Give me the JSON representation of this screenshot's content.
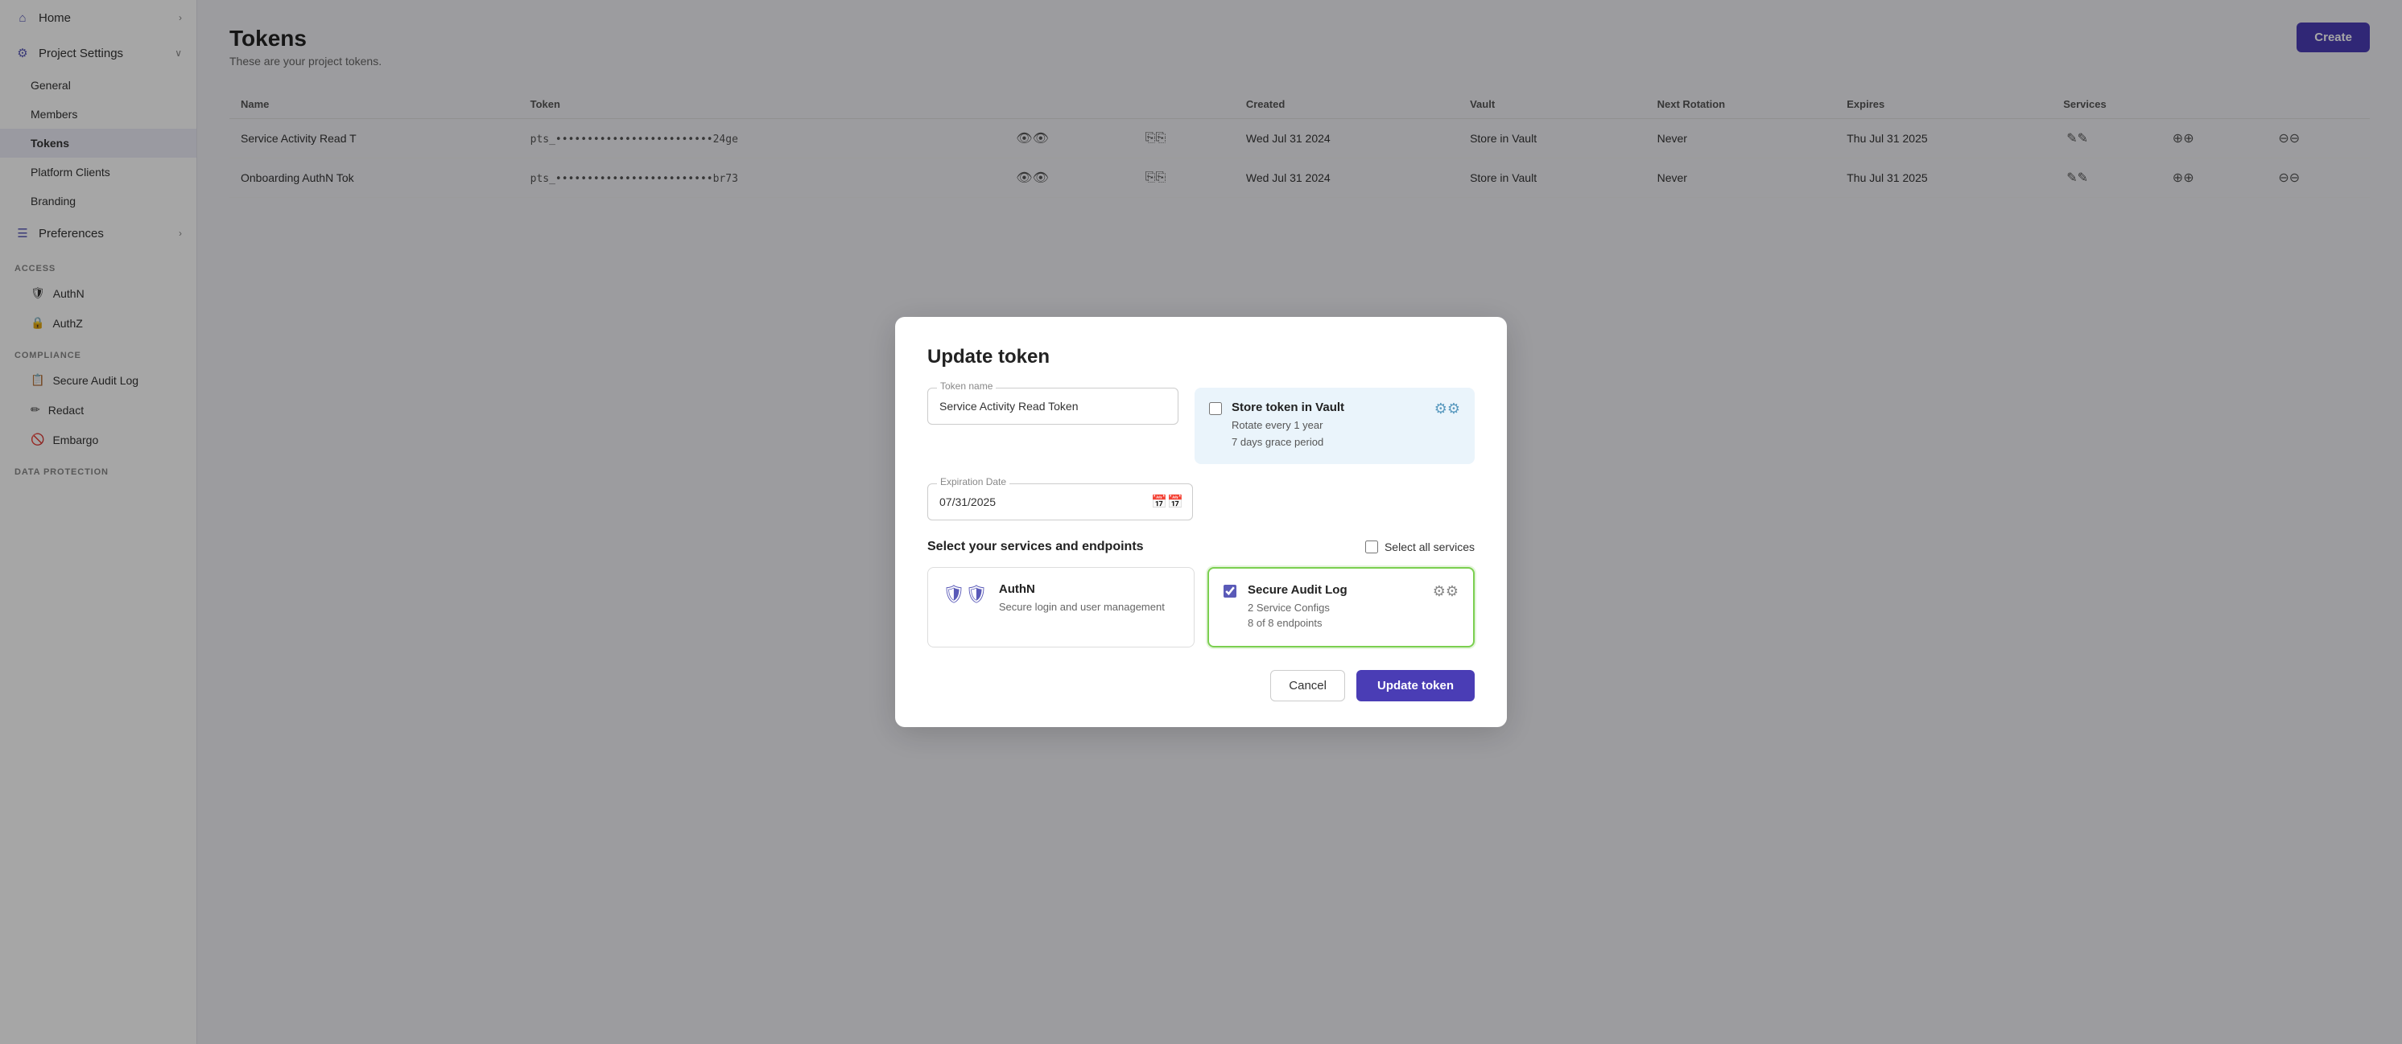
{
  "sidebar": {
    "home_label": "Home",
    "project_settings_label": "Project Settings",
    "general_label": "General",
    "members_label": "Members",
    "tokens_label": "Tokens",
    "platform_clients_label": "Platform Clients",
    "branding_label": "Branding",
    "preferences_label": "Preferences",
    "access_label": "ACCESS",
    "authn_label": "AuthN",
    "authz_label": "AuthZ",
    "compliance_label": "COMPLIANCE",
    "secure_audit_log_label": "Secure Audit Log",
    "redact_label": "Redact",
    "embargo_label": "Embargo",
    "data_protection_label": "DATA PROTECTION"
  },
  "page": {
    "title": "Tokens",
    "subtitle": "These are your project tokens.",
    "create_label": "Create"
  },
  "table": {
    "headers": [
      "Name",
      "Token",
      "",
      "",
      "Created",
      "Vault",
      "Next Rotation",
      "Expires",
      "Services",
      "",
      "",
      ""
    ],
    "rows": [
      {
        "name": "Service Activity Read T",
        "token": "pts_•••••••••••••••••••••••••24ge",
        "created": "Wed Jul 31 2024",
        "vault": "Store in Vault",
        "next_rotation": "Never",
        "expires": "Thu Jul 31 2025"
      },
      {
        "name": "Onboarding AuthN Tok",
        "token": "pts_•••••••••••••••••••••••••br73",
        "created": "Wed Jul 31 2024",
        "vault": "Store in Vault",
        "next_rotation": "Never",
        "expires": "Thu Jul 31 2025"
      }
    ]
  },
  "modal": {
    "title": "Update token",
    "token_name_label": "Token name",
    "token_name_value": "Service Activity Read Token",
    "expiration_label": "Expiration Date",
    "expiration_value": "07/31/2025",
    "vault_card": {
      "title": "Store token in Vault",
      "line1": "Rotate every 1 year",
      "line2": "7 days grace period",
      "checked": false
    },
    "services_section_title": "Select your services and endpoints",
    "select_all_label": "Select all services",
    "services": [
      {
        "id": "authn",
        "icon": "shield",
        "title": "AuthN",
        "subtitle": "Secure login and user management",
        "selected": false
      },
      {
        "id": "secure-audit-log",
        "icon": "audit",
        "title": "Secure Audit Log",
        "line1": "2 Service Configs",
        "line2": "8 of 8 endpoints",
        "selected": true
      }
    ],
    "cancel_label": "Cancel",
    "update_label": "Update token"
  }
}
